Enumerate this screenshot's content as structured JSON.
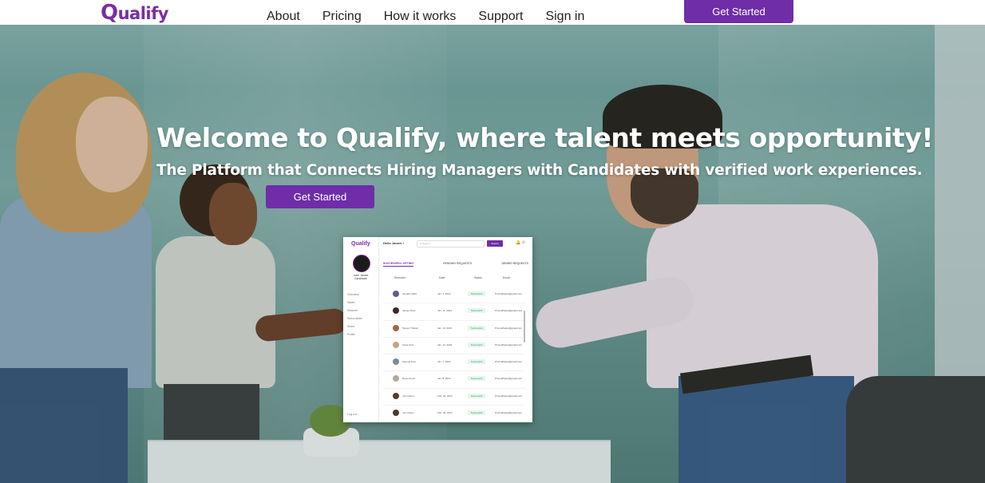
{
  "nav": {
    "logo": "Qualify",
    "links": [
      "About",
      "Pricing",
      "How it works",
      "Support",
      "Sign in"
    ],
    "cta": "Get Started"
  },
  "hero": {
    "title": "Welcome to Qualify, where talent meets opportunity!",
    "subtitle": "The Platform that Connects Hiring Managers with Candidates with verified work experiences.",
    "cta": "Get Started"
  },
  "dashboard_preview": {
    "logo": "Qualify",
    "greeting": "Hello James !",
    "search_placeholder": "Q Search",
    "search_button": "Search",
    "user_name": "John James",
    "user_role": "Candidate",
    "menu": [
      "Overview",
      "Wallet",
      "Resume",
      "Subscription",
      "Share",
      "Profile"
    ],
    "logout": "Log out",
    "tabs": [
      "SUCCESSFUL OPTING",
      "PENDING REQUESTS",
      "DENIED REQUESTS"
    ],
    "columns": [
      "Recruiter",
      "Date",
      "Status",
      "Email"
    ],
    "rows": [
      {
        "name": "Jennifer Mark",
        "date": "Jan. 7, 2024",
        "status": "Successful",
        "email": "Promailhelps@gmail.com"
      },
      {
        "name": "James Kiran",
        "date": "Jan. 11, 2024",
        "status": "Successful",
        "email": "Promailhelps@gmail.com"
      },
      {
        "name": "Steven Thakeri",
        "date": "Jan. 13, 2024",
        "status": "Successful",
        "email": "Promailhelps@gmail.com"
      },
      {
        "name": "Anna Jims",
        "date": "Jan. 14, 2024",
        "status": "Successful",
        "email": "Promailhelps@gmail.com"
      },
      {
        "name": "Samuel Koni",
        "date": "Jan. 7, 2024",
        "status": "Successful",
        "email": "Promailhelps@gmail.com"
      },
      {
        "name": "Bryce Kunst",
        "date": "Jan. 8, 2024",
        "status": "Successful",
        "email": "Promailhelps@gmail.com"
      },
      {
        "name": "John Deen",
        "date": "Feb. 18, 2024",
        "status": "Successful",
        "email": "Promailhelps@gmail.com"
      },
      {
        "name": "John Deen",
        "date": "Feb. 28, 2024",
        "status": "Successful",
        "email": "Promailhelps@gmail.com"
      }
    ]
  },
  "colors": {
    "brand": "#6f2da8",
    "logo": "#7a2ea0"
  }
}
